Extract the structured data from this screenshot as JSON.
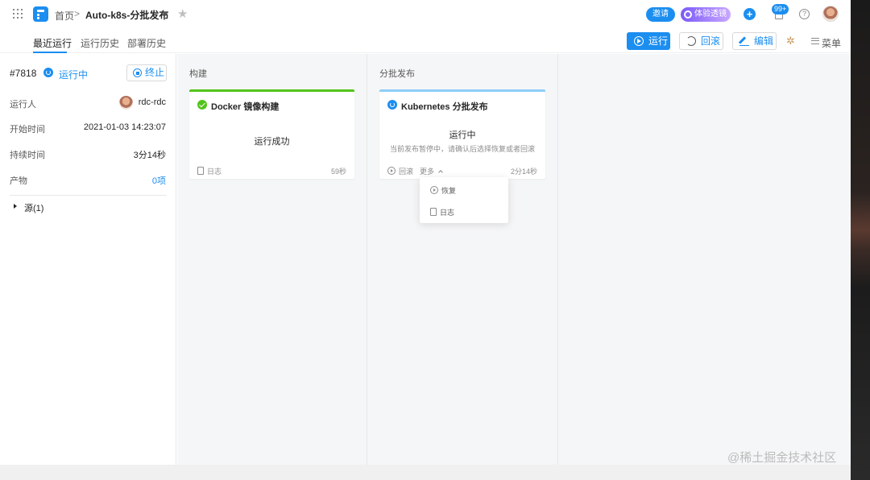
{
  "topbar": {
    "home": "首页",
    "separator": ">",
    "pipeline_title": "Auto-k8s-分批发布",
    "invite": "邀请",
    "try_new": "体验透镜",
    "notification_badge": "99+",
    "help": "?"
  },
  "subnav": {
    "tabs": [
      "最近运行",
      "运行历史",
      "部署历史"
    ],
    "run": "运行",
    "rollback": "回滚",
    "edit": "编辑",
    "menu": "菜单"
  },
  "run_panel": {
    "id": "#7818",
    "status": "运行中",
    "stop": "终止",
    "fields": [
      {
        "label": "运行人",
        "value": "rdc-rdc"
      },
      {
        "label": "开始时间",
        "value": "2021-01-03 14:23:07"
      },
      {
        "label": "持续时间",
        "value": "3分14秒"
      },
      {
        "label": "产物",
        "value": "0项"
      }
    ],
    "source": "源(1)"
  },
  "stages": [
    {
      "title": "构建",
      "job": {
        "name": "Docker 镜像构建",
        "message": "运行成功",
        "log": "日志",
        "duration": "59秒"
      }
    },
    {
      "title": "分批发布",
      "job": {
        "name": "Kubernetes 分批发布",
        "message": "运行中",
        "sub": "当前发布暂停中，请确认后选择恢复或者回滚",
        "rollback": "回滚",
        "more": "更多",
        "duration": "2分14秒",
        "menu": [
          "恢复",
          "日志"
        ]
      }
    }
  ],
  "watermark": "@稀土掘金技术社区",
  "colors": {
    "primary": "#1b8ef0",
    "success": "#52c41a",
    "running_bar": "#8ecdf8"
  }
}
